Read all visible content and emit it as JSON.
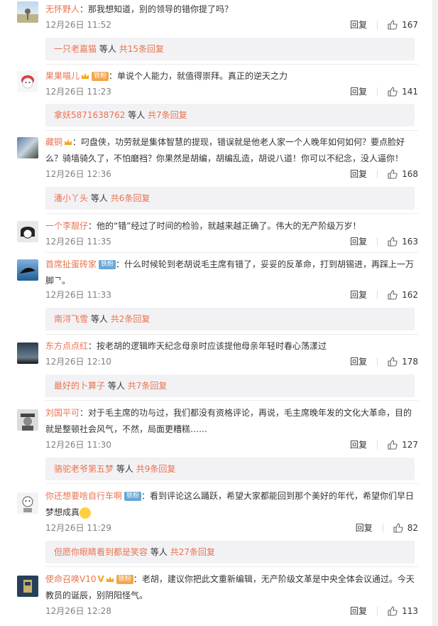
{
  "comments": [
    {
      "user": "无怀野人",
      "badge": "",
      "text": "那我想知道，别的领导的错你提了吗？",
      "time": "12月26日 11:52",
      "reply": "回复",
      "likes": "167",
      "replies": {
        "names": "一只老嘉猫",
        "suffix": "等人",
        "count": "共15条回复"
      }
    },
    {
      "user": "果果喵儿",
      "badge": "铁粉",
      "text": "单说个人能力，就值得崇拜。真正的逆天之力",
      "time": "12月26日 11:23",
      "reply": "回复",
      "likes": "141",
      "replies": {
        "names": "拿妖5871638762",
        "suffix": "等人",
        "count": "共7条回复"
      }
    },
    {
      "user": "藏铜",
      "badge": "",
      "text": "叼盘侠，功劳就是集体智慧的提现，错误就是他老人家一个人晚年如何如何？要点脸好么？骑墙骑久了，不怕磨裆？你果然是胡编，胡编乱造，胡说八道！你可以不纪念，没人逼你！",
      "time": "12月26日 12:36",
      "reply": "回复",
      "likes": "168",
      "replies": {
        "names": "潘小丫头",
        "suffix": "等人",
        "count": "共6条回复"
      }
    },
    {
      "user": "一个李靓仔",
      "badge": "",
      "text": "他的“错”经过了时间的检验，就越来越正确了。伟大的无产阶级万岁！",
      "time": "12月26日 11:35",
      "reply": "回复",
      "likes": "163",
      "replies": null
    },
    {
      "user": "首席扯蛋砖家",
      "badge": "铁粉",
      "text": "什么时候轮到老胡说毛主席有错了，妥妥的反革命，打到胡锡进，再踩上一万脚ᄀ。",
      "time": "12月26日 11:33",
      "reply": "回复",
      "likes": "162",
      "replies": {
        "names": "南浔飞雪",
        "suffix": "等人",
        "count": "共2条回复"
      }
    },
    {
      "user": "东方点点红",
      "badge": "",
      "text": "按老胡的逻辑昨天纪念母亲时应该提他母亲年轻时春心荡漾过",
      "time": "12月26日 12:10",
      "reply": "回复",
      "likes": "178",
      "replies": {
        "names": "最好的卜算子",
        "suffix": "等人",
        "count": "共7条回复"
      }
    },
    {
      "user": "刘国平可",
      "badge": "",
      "text": "对于毛主席的功与过，我们都没有资格评论，再说，毛主席晚年发的文化大革命，目的就是整顿社会风气，不然，局面更糟糕……",
      "time": "12月26日 11:30",
      "reply": "回复",
      "likes": "127",
      "replies": {
        "names": "骆驼老爷第五梦",
        "suffix": "等人",
        "count": "共9条回复"
      }
    },
    {
      "user": "你还想要啥自行车啊",
      "badge": "铁粉",
      "text": "看到评论这么踊跃，希望大家都能回到那个美好的年代，希望你们早日梦想成真",
      "time": "12月26日 11:29",
      "reply": "回复",
      "likes": "82",
      "replies": {
        "names": "但愿你眼睛看到都是笑容",
        "suffix": "等人",
        "count": "共27条回复"
      }
    },
    {
      "user": "使命召唤V10",
      "badge": "铁粉",
      "text": "老胡，建议你把此文重新编辑，无产阶级文革是中央全体会议通过。今天教员的诞辰，别阴阳怪气。",
      "time": "12月26日 12:28",
      "reply": "回复",
      "likes": "113",
      "replies": null
    }
  ],
  "colors": {
    "username": "#eb7350",
    "meta": "#808080",
    "reply_box": "#f2f2f5"
  }
}
